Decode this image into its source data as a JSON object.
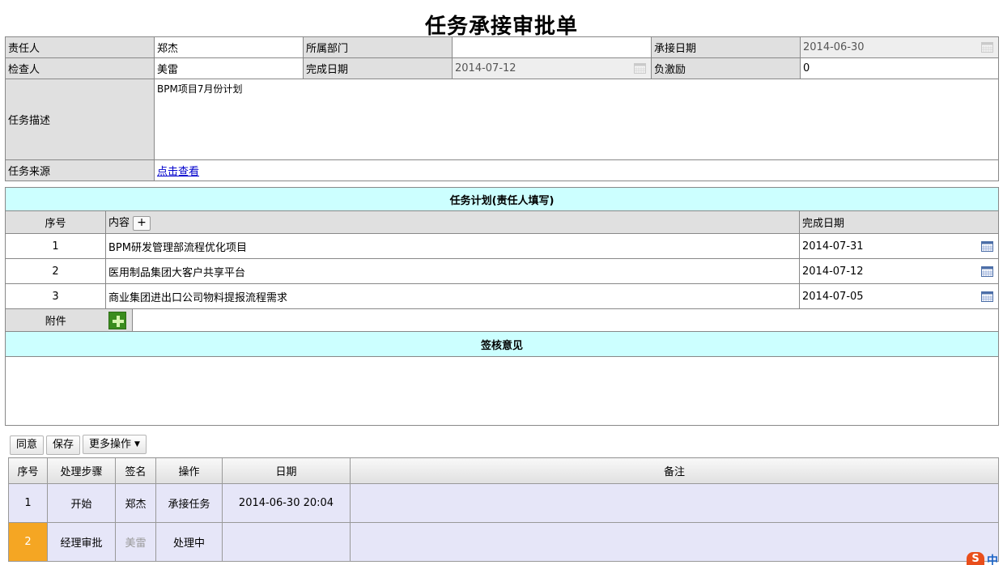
{
  "title": "任务承接审批单",
  "form": {
    "responsible_label": "责任人",
    "responsible_value": "郑杰",
    "dept_label": "所属部门",
    "dept_value": "",
    "accept_date_label": "承接日期",
    "accept_date_value": "2014-06-30",
    "checker_label": "检查人",
    "checker_value": "美雷",
    "finish_date_label": "完成日期",
    "finish_date_value": "2014-07-12",
    "penalty_label": "负激励",
    "penalty_value": "0",
    "desc_label": "任务描述",
    "desc_value": "BPM项目7月份计划",
    "source_label": "任务来源",
    "source_link": "点击查看"
  },
  "plan": {
    "section_title": "任务计划(责任人填写)",
    "col_seq": "序号",
    "col_content": "内容",
    "add_symbol": "+",
    "col_date": "完成日期",
    "rows": [
      {
        "seq": "1",
        "content": "BPM研发管理部流程优化项目",
        "date": "2014-07-31"
      },
      {
        "seq": "2",
        "content": "医用制品集团大客户共享平台",
        "date": "2014-07-12"
      },
      {
        "seq": "3",
        "content": "商业集团进出口公司物料提报流程需求",
        "date": "2014-07-05"
      }
    ],
    "attachment_label": "附件"
  },
  "review": {
    "section_title": "签核意见",
    "text": ""
  },
  "toolbar": {
    "agree": "同意",
    "save": "保存",
    "more": "更多操作"
  },
  "flow": {
    "headers": [
      "序号",
      "处理步骤",
      "签名",
      "操作",
      "日期",
      "备注"
    ],
    "rows": [
      {
        "seq": "1",
        "step": "开始",
        "sign": "郑杰",
        "op": "承接任务",
        "date": "2014-06-30 20:04",
        "note": ""
      },
      {
        "seq": "2",
        "step": "经理审批",
        "sign": "美雷",
        "op": "处理中",
        "date": "",
        "note": ""
      }
    ]
  },
  "ime": {
    "logo": "S",
    "mode": "中"
  },
  "colors": {
    "section_bg": "#ccffff",
    "label_bg": "#e0e0e0",
    "current_step": "#f5a623",
    "flow_row_bg": "#e6e6f8",
    "link": "#0000cc"
  }
}
